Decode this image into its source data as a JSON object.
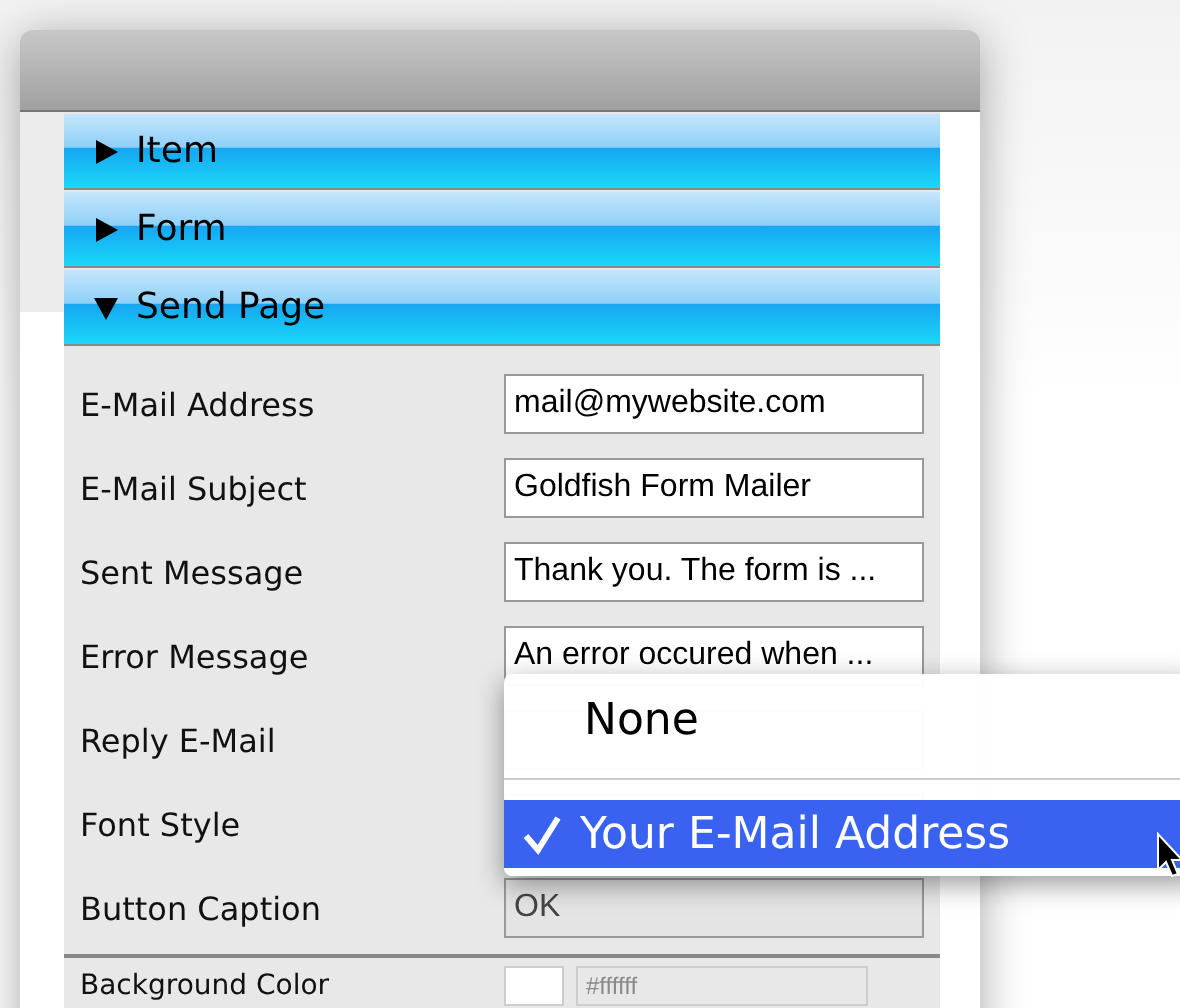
{
  "sections": [
    {
      "label": "Item",
      "expanded": false
    },
    {
      "label": "Form",
      "expanded": false
    },
    {
      "label": "Send Page",
      "expanded": true
    }
  ],
  "fields": [
    {
      "label": "E-Mail Address",
      "value": "mail@mywebsite.com"
    },
    {
      "label": "E-Mail Subject",
      "value": "Goldfish Form Mailer"
    },
    {
      "label": "Sent Message",
      "value": "Thank you. The form is ..."
    },
    {
      "label": "Error Message",
      "value": "An error occured when ..."
    },
    {
      "label": "Reply E-Mail"
    },
    {
      "label": "Font Style"
    },
    {
      "label": "Button Caption",
      "value": "OK"
    }
  ],
  "extra_field": {
    "label": "Background Color",
    "value": "#ffffff",
    "disabled": true
  },
  "popup_menu": [
    {
      "kind": "item",
      "label": "None",
      "selected": false
    },
    {
      "kind": "separator"
    },
    {
      "kind": "item",
      "label": "Your E-Mail Address",
      "selected": true
    }
  ]
}
